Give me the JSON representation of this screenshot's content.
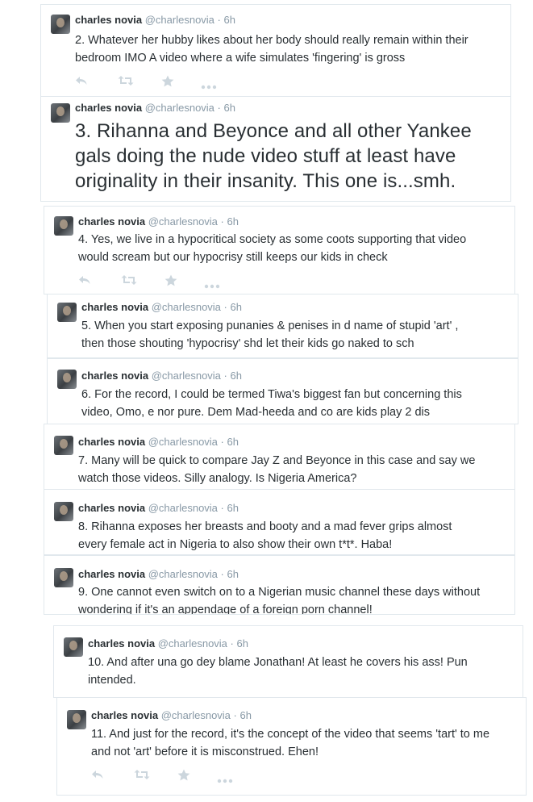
{
  "tweets": [
    {
      "name": "charles novia",
      "handle": "@charlesnovia",
      "sep": "·",
      "time": "6h",
      "text": "2. Whatever her hubby likes about her body should really remain within their\nbedroom IMO A video where a wife simulates 'fingering' is gross"
    },
    {
      "name": "charles novia",
      "handle": "@charlesnovia",
      "sep": "·",
      "time": "6h",
      "text": "3. Rihanna and Beyonce and all other Yankee\ngals doing the nude video stuff at least have\noriginality in their insanity. This one is...smh."
    },
    {
      "name": "charles novia",
      "handle": "@charlesnovia",
      "sep": "·",
      "time": "6h",
      "text": "4. Yes, we live in a hypocritical society as some coots supporting that video\nwould scream but our hypocrisy still keeps our kids in check"
    },
    {
      "name": "charles novia",
      "handle": "@charlesnovia",
      "sep": "·",
      "time": "6h",
      "text": "5. When you start exposing punanies & penises in d name of stupid 'art' ,\nthen those shouting 'hypocrisy' shd let their kids go naked to sch"
    },
    {
      "name": "charles novia",
      "handle": "@charlesnovia",
      "sep": "·",
      "time": "6h",
      "text": "6. For the record, I could be termed Tiwa's biggest fan but concerning this\nvideo, Omo, e nor pure. Dem Mad-heeda and co are kids play 2 dis"
    },
    {
      "name": "charles novia",
      "handle": "@charlesnovia",
      "sep": "·",
      "time": "6h",
      "text": "7. Many will be quick to compare Jay Z and Beyonce in this case and say we\nwatch those videos. Silly analogy. Is Nigeria America?"
    },
    {
      "name": "charles novia",
      "handle": "@charlesnovia",
      "sep": "·",
      "time": "6h",
      "text": "8. Rihanna exposes her breasts and booty and a mad fever grips almost\nevery female act in Nigeria to also show their own t*t*. Haba!"
    },
    {
      "name": "charles novia",
      "handle": "@charlesnovia",
      "sep": "·",
      "time": "6h",
      "text": "9. One cannot even switch on to a Nigerian music channel these days without\nwondering if it's an appendage of a foreign porn channel!"
    },
    {
      "name": "charles novia",
      "handle": "@charlesnovia",
      "sep": "·",
      "time": "6h",
      "text": "10. And after una go dey blame Jonathan! At least he covers his ass! Pun\nintended."
    },
    {
      "name": "charles novia",
      "handle": "@charlesnovia",
      "sep": "·",
      "time": "6h",
      "text": "11. And just for the record, it's the concept of the video that seems 'tart' to me\nand not 'art' before it is misconstrued. Ehen!"
    }
  ],
  "icons": {
    "reply": "reply-icon",
    "retweet": "retweet-icon",
    "favorite": "star-icon",
    "more": "more-icon"
  },
  "colors": {
    "text": "#292f33",
    "muted": "#8899a6",
    "icon": "#ccd6dd",
    "border": "#e1e8ed"
  }
}
